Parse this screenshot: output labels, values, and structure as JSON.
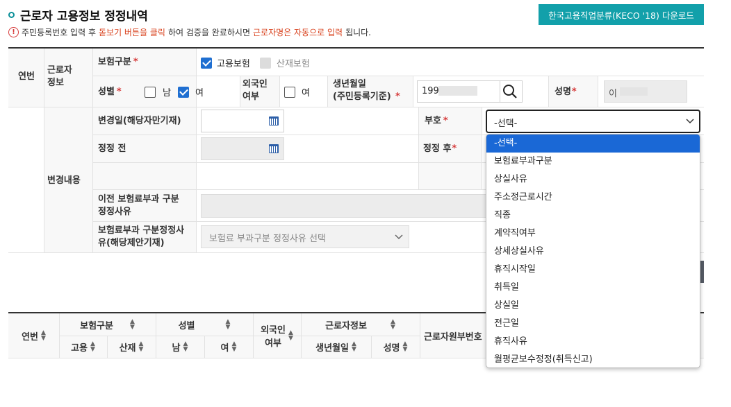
{
  "header": {
    "title": "근로자 고용정보 정정내역",
    "download_button": "한국고용직업분류(KECO '18) 다운로드"
  },
  "notice": {
    "part1": "주민등록번호 입력 후 ",
    "part2": "돋보기 버튼을 클릭",
    "part3": "하여 검증을 완료하시면 ",
    "part4": "근로자명은 자동으로 입력",
    "part5": "됩니다."
  },
  "form": {
    "yeonbeon_label": "연번",
    "worker_info_label": "근로자\n정보",
    "insurance_type_label": "보험구분",
    "employment_insurance_label": "고용보험",
    "industrial_insurance_label": "산재보험",
    "gender_label": "성별",
    "male_label": "남",
    "female_label": "여",
    "foreigner_label": "외국인\n여부",
    "foreigner_option": "여",
    "birth_label": "생년월일\n(주민등록기준)",
    "birth_value": "199",
    "name_label": "성명",
    "name_value": "이",
    "change_content_label": "변경내용",
    "change_date_label": "변경일(해당자만기재)",
    "code_label": "부호",
    "select_value": "-선택-",
    "before_label": "정정 전",
    "after_label": "정정 후",
    "prev_reason_label": "이전 보험료부과 구분\n정정사유",
    "reason_label": "보험료부과 구분정정사\n유(해당제안기재)",
    "reason_placeholder": "보험료 부과구분 정정사유 선택"
  },
  "dropdown": {
    "items": [
      "-선택-",
      "보험료부과구분",
      "상실사유",
      "주소정근로시간",
      "직종",
      "계약직여부",
      "상세상실사유",
      "휴직시작일",
      "취득일",
      "상실일",
      "전근일",
      "휴직사유",
      "월평균보수정정(취득신고)"
    ]
  },
  "table": {
    "yeonbeon": "연번",
    "insurance_type": "보험구분",
    "employment": "고용",
    "industrial": "산재",
    "gender": "성별",
    "male": "남",
    "female": "여",
    "foreigner": "외국인\n여부",
    "worker_info": "근로자정보",
    "birth": "생년월일",
    "name": "성명",
    "worker_no": "근로자원부번호"
  },
  "colors": {
    "accent": "#12a0aa",
    "required": "#d63a3a",
    "highlight": "#1a68d6"
  }
}
